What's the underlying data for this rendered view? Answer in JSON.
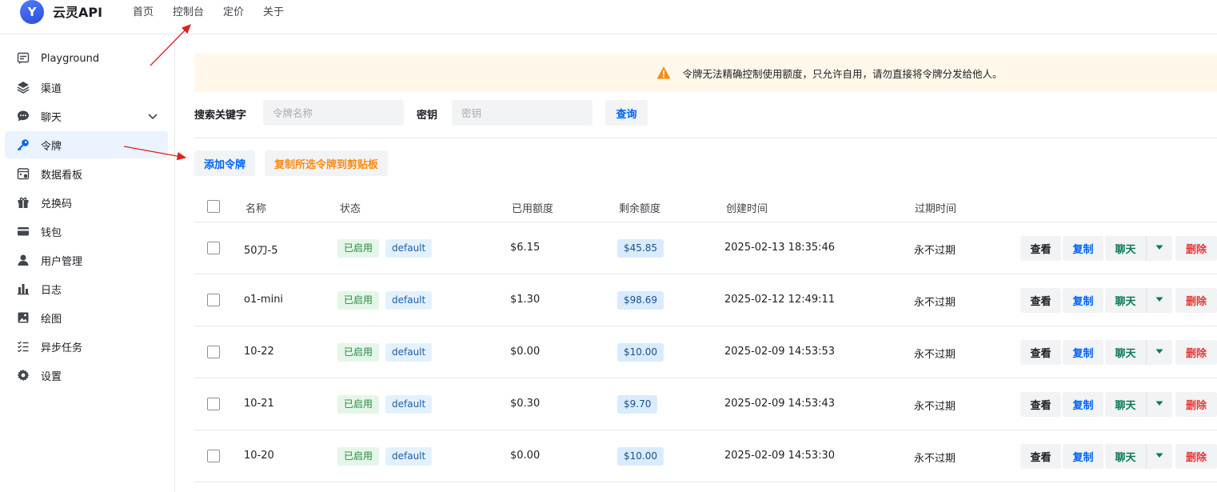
{
  "header": {
    "brand": "云灵API",
    "logo_letter": "Y",
    "nav": [
      "首页",
      "控制台",
      "定价",
      "关于"
    ]
  },
  "sidebar": {
    "items": [
      {
        "label": "Playground",
        "icon": "chat-square-icon"
      },
      {
        "label": "渠道",
        "icon": "layers-icon"
      },
      {
        "label": "聊天",
        "icon": "chat-bubble-icon",
        "expandable": true
      },
      {
        "label": "令牌",
        "icon": "key-icon",
        "active": true
      },
      {
        "label": "数据看板",
        "icon": "dashboard-calendar-icon"
      },
      {
        "label": "兑换码",
        "icon": "gift-icon"
      },
      {
        "label": "钱包",
        "icon": "wallet-icon"
      },
      {
        "label": "用户管理",
        "icon": "user-icon"
      },
      {
        "label": "日志",
        "icon": "bar-chart-icon"
      },
      {
        "label": "绘图",
        "icon": "image-icon"
      },
      {
        "label": "异步任务",
        "icon": "checklist-icon"
      },
      {
        "label": "设置",
        "icon": "gear-icon"
      }
    ]
  },
  "banner": {
    "text": "令牌无法精确控制使用额度，只允许自用，请勿直接将令牌分发给他人。"
  },
  "search": {
    "keyword_label": "搜索关键字",
    "name_placeholder": "令牌名称",
    "key_label": "密钥",
    "key_placeholder": "密钥",
    "query_label": "查询"
  },
  "actions": {
    "add_label": "添加令牌",
    "copy_selected_label": "复制所选令牌到剪贴板"
  },
  "table": {
    "columns": [
      "名称",
      "状态",
      "已用额度",
      "剩余额度",
      "创建时间",
      "过期时间"
    ],
    "rows": [
      {
        "name": "50刀-5",
        "status": "已启用",
        "group": "default",
        "used": "$6.15",
        "remaining": "$45.85",
        "created": "2025-02-13 18:35:46",
        "expires": "永不过期"
      },
      {
        "name": "o1-mini",
        "status": "已启用",
        "group": "default",
        "used": "$1.30",
        "remaining": "$98.69",
        "created": "2025-02-12 12:49:11",
        "expires": "永不过期"
      },
      {
        "name": "10-22",
        "status": "已启用",
        "group": "default",
        "used": "$0.00",
        "remaining": "$10.00",
        "created": "2025-02-09 14:53:53",
        "expires": "永不过期"
      },
      {
        "name": "10-21",
        "status": "已启用",
        "group": "default",
        "used": "$0.30",
        "remaining": "$9.70",
        "created": "2025-02-09 14:53:43",
        "expires": "永不过期"
      },
      {
        "name": "10-20",
        "status": "已启用",
        "group": "default",
        "used": "$0.00",
        "remaining": "$10.00",
        "created": "2025-02-09 14:53:30",
        "expires": "永不过期"
      }
    ],
    "row_ops": {
      "view": "查看",
      "copy": "复制",
      "chat": "聊天",
      "delete": "删除"
    }
  },
  "colors": {
    "accent": "#0064fa",
    "danger": "#e53935",
    "warning": "#fa8c16",
    "annotation_arrow": "#e02020"
  }
}
